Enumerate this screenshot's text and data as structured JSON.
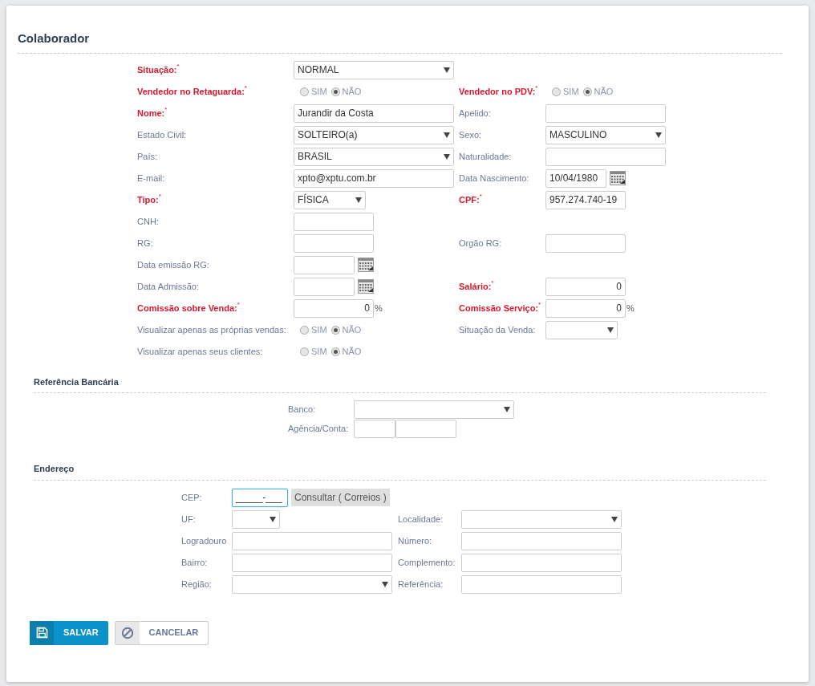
{
  "title": "Colaborador",
  "main_rows": [
    {
      "left": {
        "label": "Situação:",
        "required_mark": "*",
        "kind": "dropdown",
        "value": "NORMAL"
      }
    },
    {
      "left": {
        "label": "Vendedor no Retaguarda:",
        "required_mark": "*",
        "kind": "radio",
        "options": [
          {
            "label": "SIM",
            "selected": false
          },
          {
            "label": "NÃO",
            "selected": true
          }
        ]
      },
      "right": {
        "label": "Vendedor no PDV:",
        "required_mark": "*",
        "kind": "radio",
        "options": [
          {
            "label": "SIM",
            "selected": false
          },
          {
            "label": "NÃO",
            "selected": true
          }
        ]
      }
    },
    {
      "left": {
        "label": "Nome:",
        "required_mark": "*",
        "kind": "text",
        "value": "Jurandir da Costa"
      },
      "right": {
        "label": "Apelido:",
        "kind": "text"
      }
    },
    {
      "left": {
        "label": "Estado Civil:",
        "kind": "dropdown",
        "value": "SOLTEIRO(a)"
      },
      "right": {
        "label": "Sexo:",
        "kind": "dropdown",
        "value": "MASCULINO"
      }
    },
    {
      "left": {
        "label": "País:",
        "kind": "dropdown",
        "value": "BRASIL"
      },
      "right": {
        "label": "Naturalidade:",
        "kind": "text"
      }
    },
    {
      "left": {
        "label": "E-mail:",
        "kind": "text",
        "value": "xpto@xptu.com.br"
      },
      "right": {
        "label": "Data Nascimento:",
        "kind": "date",
        "value": "10/04/1980"
      }
    },
    {
      "left": {
        "label": "Tipo:",
        "required_mark": "*",
        "kind": "picker",
        "value": "FÍSICA"
      },
      "right": {
        "label": "CPF:",
        "required_mark": "*",
        "kind": "entry",
        "value": "957.274.740-19"
      }
    },
    {
      "left": {
        "label": "CNH:",
        "kind": "entry"
      }
    },
    {
      "left": {
        "label": "RG:",
        "kind": "entry"
      },
      "right": {
        "label": "Orgão RG:",
        "kind": "entry"
      }
    },
    {
      "left": {
        "label": "Data emissão RG:",
        "kind": "date"
      }
    },
    {
      "left": {
        "label": "Data Admissão:",
        "kind": "date"
      },
      "right": {
        "label": "Salário:",
        "required_mark": "*",
        "kind": "number",
        "value": "0"
      }
    },
    {
      "left": {
        "label": "Comissão sobre Venda:",
        "required_mark": "*",
        "kind": "percent",
        "value": "0",
        "suffix": "%"
      },
      "right": {
        "label": "Comissão Serviço:",
        "required_mark": "*",
        "kind": "percent",
        "value": "0",
        "suffix": "%"
      }
    },
    {
      "left": {
        "label": "Visualizar apenas as próprias vendas:",
        "kind": "radio",
        "options": [
          {
            "label": "SIM",
            "selected": false
          },
          {
            "label": "NÃO",
            "selected": true
          }
        ]
      },
      "right": {
        "label": "Situação da Venda:",
        "kind": "picker"
      }
    },
    {
      "left": {
        "label": "Visualizar apenas seus clientes:",
        "kind": "radio",
        "options": [
          {
            "label": "SIM",
            "selected": false
          },
          {
            "label": "NÃO",
            "selected": true
          }
        ]
      }
    }
  ],
  "bank": {
    "title": "Referência Bancária",
    "rows": [
      {
        "left": {
          "label": "Banco:",
          "kind": "dropdown"
        }
      },
      {
        "left": {
          "label": "Agência/Conta:",
          "kind": "pair"
        }
      }
    ]
  },
  "address": {
    "title": "Endereço",
    "rows": [
      {
        "left": {
          "label": "CEP:",
          "kind": "cep",
          "value": "_____-___",
          "button": "Consultar ( Correios )"
        }
      },
      {
        "left": {
          "label": "UF:",
          "kind": "picker"
        },
        "right": {
          "label": "Localidade:",
          "kind": "dropdown"
        }
      },
      {
        "left": {
          "label": "Logradouro",
          "kind": "text"
        },
        "right": {
          "label": "Número:",
          "kind": "text"
        }
      },
      {
        "left": {
          "label": "Bairro:",
          "kind": "text"
        },
        "right": {
          "label": "Complemento:",
          "kind": "text"
        }
      },
      {
        "left": {
          "label": "Região:",
          "kind": "dropdown"
        },
        "right": {
          "label": "Referência:",
          "kind": "text"
        }
      }
    ]
  },
  "buttons": [
    {
      "label": "SALVAR",
      "kind": "primary"
    },
    {
      "label": "CANCELAR",
      "kind": "secondary"
    }
  ]
}
